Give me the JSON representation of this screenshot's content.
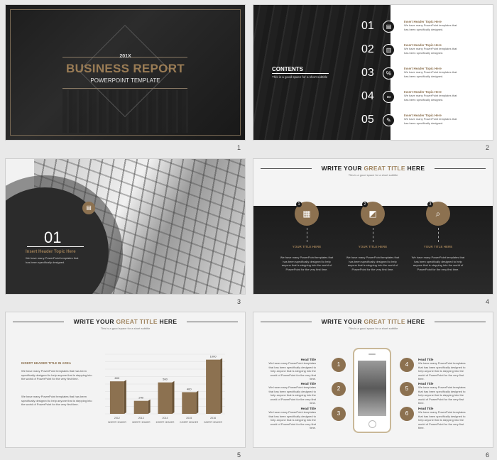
{
  "slides": {
    "s1": {
      "number": "1",
      "year": "201X",
      "title": "BUSINESS REPORT",
      "subtitle": "POWERPOINT TEMPLATE"
    },
    "s2": {
      "number": "2",
      "contents_title": "CONTENTS",
      "contents_sub": "This is a good space for a short subtitle",
      "items": [
        {
          "num": "01",
          "icon": "document-icon",
          "glyph": "▤",
          "head": "Insert Header Topic Here",
          "body": "We have many PowerPoint templates that has been specifically designed."
        },
        {
          "num": "02",
          "icon": "file-icon",
          "glyph": "▥",
          "head": "Insert Header Topic Here",
          "body": "We have many PowerPoint templates that has been specifically designed."
        },
        {
          "num": "03",
          "icon": "percent-icon",
          "glyph": "%",
          "head": "Insert Header Topic Here",
          "body": "We have many PowerPoint templates that has been specifically designed."
        },
        {
          "num": "04",
          "icon": "link-icon",
          "glyph": "∞",
          "head": "Insert Header Topic Here",
          "body": "We have many PowerPoint templates that has been specifically designed."
        },
        {
          "num": "05",
          "icon": "edit-icon",
          "glyph": "✎",
          "head": "Insert Header Topic Here",
          "body": "We have many PowerPoint templates that has been specifically designed."
        }
      ]
    },
    "s3": {
      "number": "3",
      "section_num": "01",
      "head": "Insert Header Topic Here",
      "body": "We have many PowerPoint templates that has been specifically designed."
    },
    "s4": {
      "number": "4",
      "title_pre": "WRITE  YOUR ",
      "title_gold": "GREAT  TITLE",
      "title_post": " HERE",
      "subtitle": "This is a good space for a short subtitle",
      "cols": [
        {
          "badge": "1",
          "glyph": "▦",
          "title": "YOUR TITLE HERE",
          "body": "We have many PowerPoint templates that has been specifically designed to help anyone that is stepping into the world of PowerPoint for the very first time."
        },
        {
          "badge": "2",
          "glyph": "◩",
          "title": "YOUR TITLE HERE",
          "body": "We have many PowerPoint templates that has been specifically designed to help anyone that is stepping into the world of PowerPoint for the very first time."
        },
        {
          "badge": "3",
          "glyph": "⌕",
          "title": "YOUR TITLE HERE",
          "body": "We have many PowerPoint templates that has been specifically designed to help anyone that is stepping into the world of PowerPoint for the very first time."
        }
      ]
    },
    "s5": {
      "number": "5",
      "title_pre": "WRITE  YOUR ",
      "title_gold": "GREAT  TITLE",
      "title_post": " HERE",
      "subtitle": "This is a good space for a short subtitle",
      "left_head": "INSERT HEADER TITLE IN AREA",
      "left_p1": "We have many PowerPoint templates that has been specifically designed to help anyone that is stepping into the world of PowerPoint for the very first time.",
      "left_p2": "We have many PowerPoint templates that has been specifically designed to help anyone that is stepping into the world of PowerPoint for the very first time."
    },
    "s6": {
      "number": "6",
      "title_pre": "WRITE  YOUR ",
      "title_gold": "GREAT  TITLE",
      "title_post": " HERE",
      "subtitle": "This is a good space for a short subtitle",
      "items": [
        {
          "n": "1",
          "head": "Head Title",
          "body": "We have many PowerPoint templates that has been specifically designed to help anyone that is stepping into the world of PowerPoint for the very first time."
        },
        {
          "n": "2",
          "head": "Head Title",
          "body": "We have many PowerPoint templates that has been specifically designed to help anyone that is stepping into the world of PowerPoint for the very first time."
        },
        {
          "n": "3",
          "head": "Head Title",
          "body": "We have many PowerPoint templates that has been specifically designed to help anyone that is stepping into the world of PowerPoint for the very first time."
        },
        {
          "n": "4",
          "head": "Head Title",
          "body": "We have many PowerPoint templates that has been specifically designed to help anyone that is stepping into the world of PowerPoint for the very first time."
        },
        {
          "n": "5",
          "head": "Head Title",
          "body": "We have many PowerPoint templates that has been specifically designed to help anyone that is stepping into the world of PowerPoint for the very first time."
        },
        {
          "n": "6",
          "head": "Head Title",
          "body": "We have many PowerPoint templates that has been specifically designed to help anyone that is stepping into the world of PowerPoint for the very first time."
        }
      ]
    }
  },
  "chart_data": {
    "type": "bar",
    "categories": [
      "2012",
      "2013",
      "2014",
      "2015",
      "2016"
    ],
    "x_sublabels": [
      "INSERT HEADER",
      "INSERT HEADER",
      "INSERT HEADER",
      "INSERT HEADER",
      "INSERT HEADER"
    ],
    "values": [
      600,
      240,
      580,
      400,
      1000
    ],
    "value_labels": [
      "600",
      "240",
      "580",
      "400",
      "1000"
    ],
    "ylim": [
      0,
      1100
    ],
    "bar_color": "#8c7150"
  },
  "colors": {
    "accent": "#8c7150",
    "dark": "#1c1c1c"
  }
}
